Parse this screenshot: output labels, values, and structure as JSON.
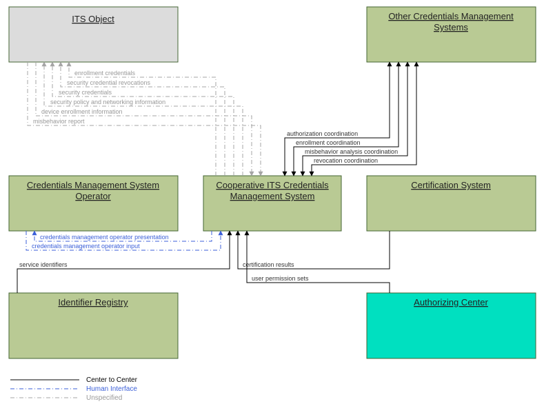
{
  "boxes": {
    "its_object": "ITS Object",
    "other_cms": "Other Credentials Management",
    "other_cms_line2": "Systems",
    "cms_operator": "Credentials Management System",
    "cms_operator_line2": "Operator",
    "coop_its": "Cooperative ITS Credentials",
    "coop_its_line2": "Management System",
    "cert_system": "Certification System",
    "id_registry": "Identifier Registry",
    "auth_center": "Authorizing Center"
  },
  "flows": {
    "enrollment_credentials": "enrollment credentials",
    "security_credential_revocations": "security credential revocations",
    "security_credentials": "security credentials",
    "security_policy_net": "security policy and networking information",
    "device_enrollment_info": "device enrollment information",
    "misbehavior_report": "misbehavior report",
    "authorization_coordination": "authorization coordination",
    "enrollment_coordination": "enrollment coordination",
    "misbehavior_analysis_coord": "misbehavior analysis coordination",
    "revocation_coordination": "revocation coordination",
    "cred_mgmt_op_presentation": "credentials management operator presentation",
    "cred_mgmt_op_input": "credentials management operator input",
    "service_identifiers": "service identifiers",
    "certification_results": "certification results",
    "user_permission_sets": "user permission sets"
  },
  "legend": {
    "center_to_center": "Center to Center",
    "human_interface": "Human Interface",
    "unspecified": "Unspecified"
  }
}
